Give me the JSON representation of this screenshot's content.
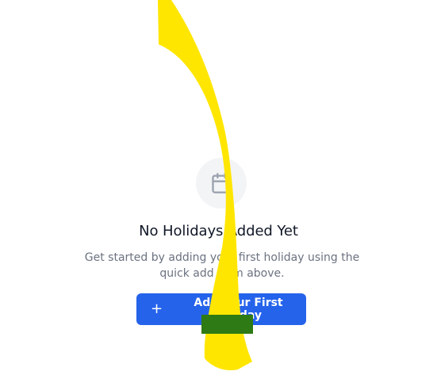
{
  "empty_state": {
    "icon": "calendar-icon",
    "title": "No Holidays Added Yet",
    "description": "Get started by adding your first holiday using the quick add form above.",
    "button_icon": "+",
    "button_label": "Add Your First Holiday"
  },
  "colors": {
    "primary": "#2563eb",
    "highlight": "#ffe600",
    "icon_bg": "#f3f4f6",
    "icon_stroke": "#9ca3af"
  }
}
